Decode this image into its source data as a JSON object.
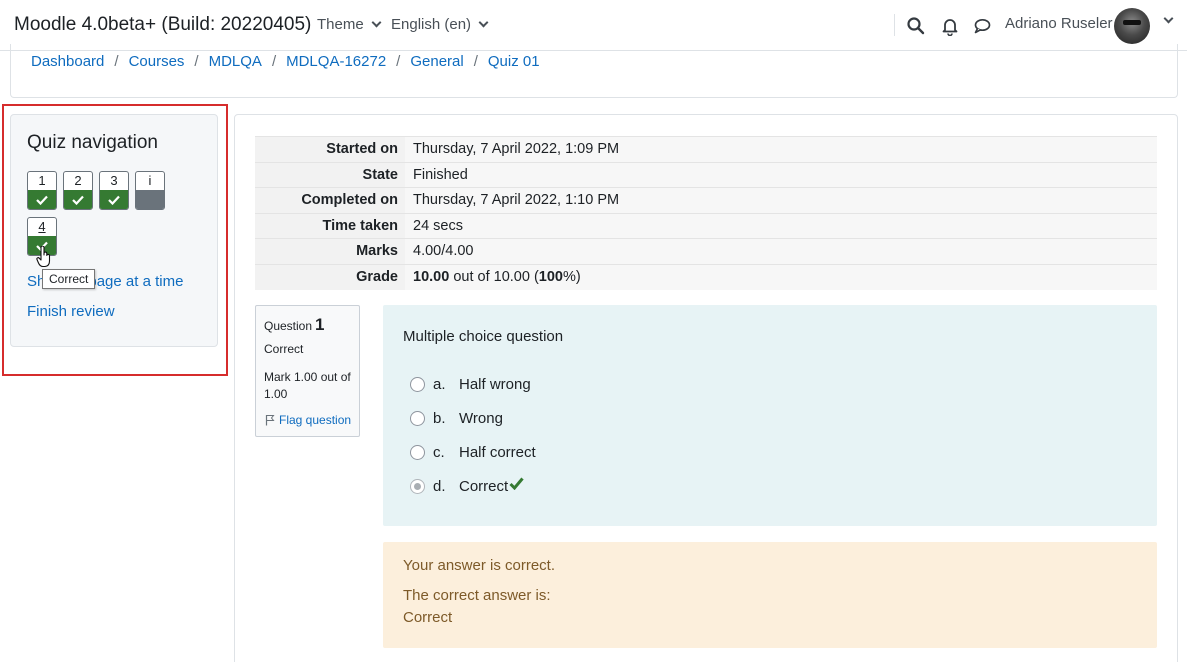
{
  "header": {
    "brand": "Moodle 4.0beta+ (Build: 20220405)",
    "menus": [
      {
        "label": "Theme"
      },
      {
        "label": "English (en)"
      }
    ],
    "icons": [
      "search-icon",
      "bell-icon",
      "chat-icon"
    ],
    "user_name": "Adriano Ruseler"
  },
  "breadcrumb": [
    "Dashboard",
    "Courses",
    "MDLQA",
    "MDLQA-16272",
    "General",
    "Quiz 01"
  ],
  "quiz_nav": {
    "title": "Quiz navigation",
    "buttons": [
      {
        "label": "1",
        "state": "correct"
      },
      {
        "label": "2",
        "state": "correct"
      },
      {
        "label": "3",
        "state": "correct"
      },
      {
        "label": "i",
        "state": "info"
      },
      {
        "label": "4",
        "state": "correct"
      }
    ],
    "tooltip": "Correct",
    "show_one_page_prefix": "Sh",
    "show_one_page_suffix": "page at a time",
    "finish_review": "Finish review"
  },
  "summary": [
    {
      "label": "Started on",
      "value": "Thursday, 7 April 2022, 1:09 PM"
    },
    {
      "label": "State",
      "value": "Finished"
    },
    {
      "label": "Completed on",
      "value": "Thursday, 7 April 2022, 1:10 PM"
    },
    {
      "label": "Time taken",
      "value": "24 secs"
    },
    {
      "label": "Marks",
      "value": "4.00/4.00"
    }
  ],
  "grade": {
    "label": "Grade",
    "score": "10.00",
    "out_of": "out of 10.00",
    "percent": "100",
    "percent_open": "(",
    "percent_close": "%)"
  },
  "question": {
    "label": "Question",
    "number": "1",
    "state": "Correct",
    "grade": "Mark 1.00 out of 1.00",
    "flag": "Flag question",
    "text": "Multiple choice question",
    "answers": [
      {
        "letter": "a.",
        "text": "Half wrong",
        "checked": false
      },
      {
        "letter": "b.",
        "text": "Wrong",
        "checked": false
      },
      {
        "letter": "c.",
        "text": "Half correct",
        "checked": false
      },
      {
        "letter": "d.",
        "text": "Correct",
        "checked": true
      }
    ],
    "feedback": {
      "result": "Your answer is correct.",
      "right_answer_label": "The correct answer is:",
      "right_answer": "Correct"
    }
  },
  "colors": {
    "link": "#0f6cbf",
    "correct": "#357a32",
    "highlight": "#d62c2c",
    "feedback_bg": "#fcefdc",
    "question_bg": "#e7f3f5"
  }
}
